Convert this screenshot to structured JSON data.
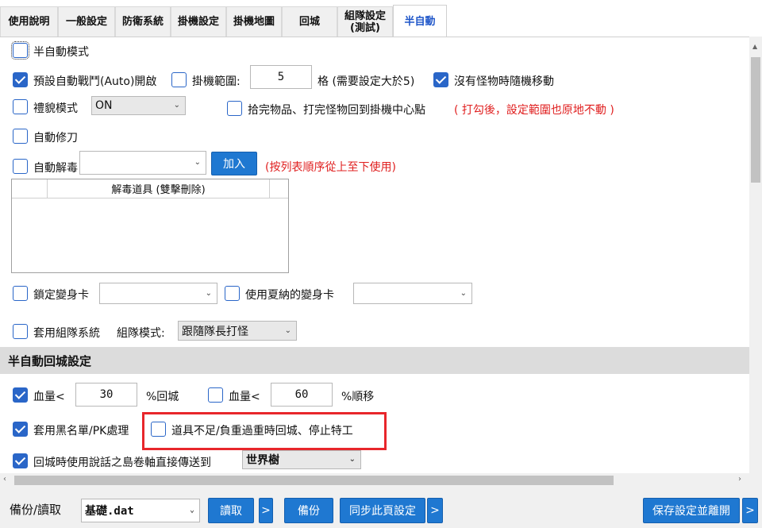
{
  "tabs": [
    {
      "label": "使用說明",
      "active": false
    },
    {
      "label": "一般設定",
      "active": false
    },
    {
      "label": "防衛系統",
      "active": false
    },
    {
      "label": "掛機設定",
      "active": false
    },
    {
      "label": "掛機地圖",
      "active": false
    },
    {
      "label": "回城",
      "active": false
    },
    {
      "label": "組隊設定\n(測試)",
      "active": false,
      "line1": "組隊設定",
      "line2": "(測試)"
    },
    {
      "label": "半自動",
      "active": true
    }
  ],
  "opts": {
    "semi_auto_mode": {
      "label": "半自動模式",
      "checked": false
    },
    "auto_battle": {
      "label": "預設自動戰鬥(Auto)開啟",
      "checked": true
    },
    "idle_range": {
      "label": "掛機範圍:",
      "checked": false,
      "value": "5",
      "suffix": "格 (需要設定大於5)"
    },
    "random_move": {
      "label": "沒有怪物時隨機移動",
      "checked": true
    },
    "courtesy": {
      "label": "禮貌模式",
      "checked": false,
      "select": "ON"
    },
    "return_center": {
      "label": "拾完物品、打完怪物回到掛機中心點",
      "checked": false,
      "note": "( 打勾後，設定範圍也原地不動 )"
    },
    "auto_repair": {
      "label": "自動修刀",
      "checked": false
    },
    "auto_detox": {
      "label": "自動解毒",
      "checked": false,
      "select": "",
      "add_button": "加入",
      "note": "(按列表順序從上至下使用)"
    },
    "detox_list_header": "解毒道具 (雙擊刪除)",
    "lock_morph": {
      "label": "鎖定變身卡",
      "checked": false,
      "select": ""
    },
    "xiana_morph": {
      "label": "使用夏納的變身卡",
      "checked": false,
      "select": ""
    },
    "party_system": {
      "label": "套用組隊系統",
      "checked": false,
      "mode_label": "組隊模式:",
      "mode_value": "跟隨隊長打怪"
    }
  },
  "section_title": "半自動回城設定",
  "return": {
    "hp": {
      "label": "血量<",
      "checked": true,
      "value": "30",
      "suffix": "%回城"
    },
    "hp2": {
      "label": "血量<",
      "checked": false,
      "value": "60",
      "suffix": "%順移"
    },
    "blacklist": {
      "label": "套用黑名單/PK處理",
      "checked": true
    },
    "no_item": {
      "label": "道具不足/負重過重時回城、停止特工",
      "checked": false
    },
    "scroll_teleport": {
      "label": "回城時使用說話之島卷軸直接傳送到",
      "checked": true,
      "select": "世界樹"
    }
  },
  "footer": {
    "backup_label": "備份/讀取",
    "file_select": "基礎.dat",
    "read_button": "讀取",
    "backup_button": "備份",
    "sync_button": "同步此頁設定",
    "save_exit_button": "保存設定並離開",
    "more": ">"
  },
  "colors": {
    "accent": "#1f78d1",
    "checkbox": "#2a66c8",
    "highlight": "#e8262b",
    "note": "#e02020"
  }
}
